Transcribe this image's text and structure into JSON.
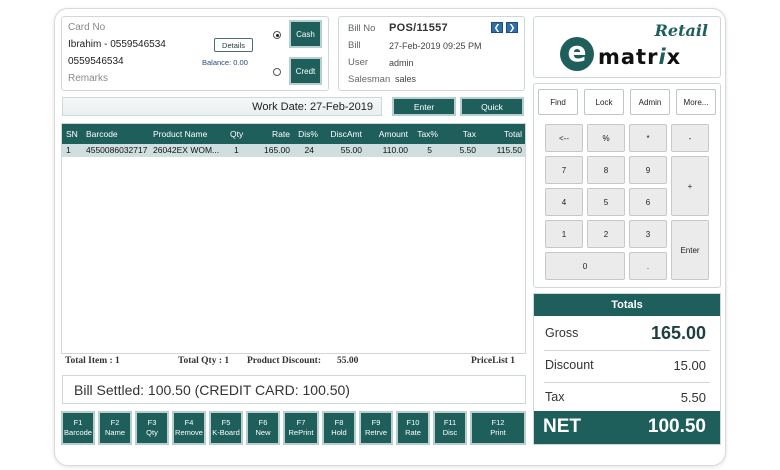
{
  "customer": {
    "card_no_label": "Card No",
    "name_phone": "Ibrahim - 0559546534",
    "phone": "0559546534",
    "remarks_label": "Remarks",
    "details_label": "Details",
    "balance": "Balance: 0.00",
    "cash_label": "Cash",
    "credit_label": "Credt"
  },
  "bill": {
    "bill_no_label": "Bill No",
    "bill_no": "POS/11557",
    "bill_label": "Bill",
    "bill_datetime": "27-Feb-2019 09:25 PM",
    "user_label": "User",
    "user": "admin",
    "salesman_label": "Salesman",
    "salesman": "sales",
    "prev_glyph": "❮",
    "next_glyph": "❯"
  },
  "logo": {
    "retail": "Retail",
    "e": "e",
    "matrix_a": "matr",
    "matrix_i": "i",
    "matrix_b": "x"
  },
  "work": {
    "date_text": "Work Date: 27-Feb-2019",
    "enter_label": "Enter",
    "quick_label": "Quick"
  },
  "grid": {
    "headers": [
      "SN",
      "Barcode",
      "Product Name",
      "Qty",
      "Rate",
      "Dis%",
      "DiscAmt",
      "Amount",
      "Tax%",
      "Tax",
      "Total"
    ],
    "rows": [
      [
        "1",
        "4550086032717",
        "26042EX WOM...",
        "1",
        "165.00",
        "24",
        "55.00",
        "110.00",
        "5",
        "5.50",
        "115.50"
      ]
    ]
  },
  "summary": {
    "total_item": "Total Item : 1",
    "total_qty": "Total Qty : 1",
    "product_discount_label": "Product Discount:",
    "product_discount": "55.00",
    "pricelist": "PriceList 1"
  },
  "settled_text": "Bill Settled: 100.50 (CREDIT CARD: 100.50)",
  "fkeys": [
    {
      "key": "F1",
      "label": "Barcode"
    },
    {
      "key": "F2",
      "label": "Name"
    },
    {
      "key": "F3",
      "label": "Qty"
    },
    {
      "key": "F4",
      "label": "Remove"
    },
    {
      "key": "F5",
      "label": "K-Board"
    },
    {
      "key": "F6",
      "label": "New"
    },
    {
      "key": "F7",
      "label": "RePrint"
    },
    {
      "key": "F8",
      "label": "Hold"
    },
    {
      "key": "F9",
      "label": "Retrve"
    },
    {
      "key": "F10",
      "label": "Rate"
    },
    {
      "key": "F11",
      "label": "Disc"
    },
    {
      "key": "F12",
      "label": "Print"
    }
  ],
  "side_buttons": {
    "find": "Find",
    "lock": "Lock",
    "admin": "Admin",
    "more": "More..."
  },
  "keypad": {
    "back": "<--",
    "percent": "%",
    "multiply": "*",
    "minus": "-",
    "k7": "7",
    "k8": "8",
    "k9": "9",
    "plus": "+",
    "k4": "4",
    "k5": "5",
    "k6": "6",
    "k1": "1",
    "k2": "2",
    "k3": "3",
    "enter": "Enter",
    "k0": "0",
    "dot": "."
  },
  "totals": {
    "title": "Totals",
    "gross_label": "Gross",
    "gross": "165.00",
    "discount_label": "Discount",
    "discount": "15.00",
    "tax_label": "Tax",
    "tax": "5.50",
    "net_label": "NET",
    "net": "100.50"
  },
  "colors": {
    "accent": "#1e5f5c",
    "row_highlight": "#cfdede",
    "nav_blue": "#2f6ea8"
  }
}
